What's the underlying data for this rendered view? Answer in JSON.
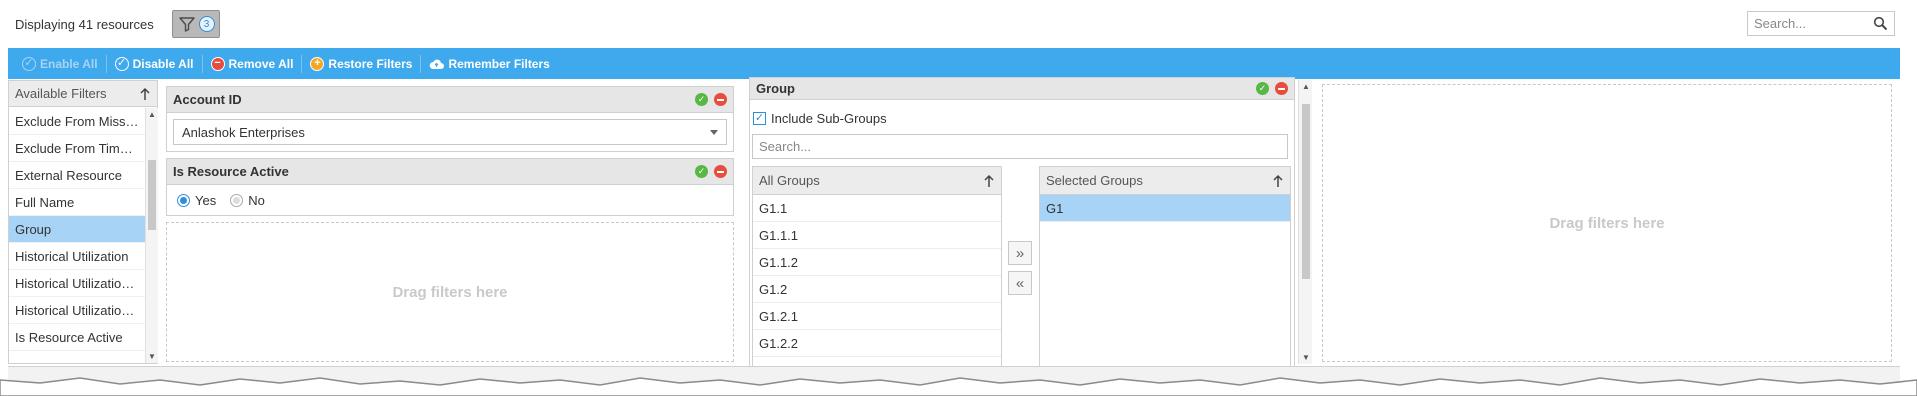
{
  "header": {
    "count_text": "Displaying 41 resources",
    "filter_badge": "3",
    "search_placeholder": "Search..."
  },
  "toolbar": {
    "enable_all": "Enable All",
    "disable_all": "Disable All",
    "remove_all": "Remove All",
    "restore_filters": "Restore Filters",
    "remember_filters": "Remember Filters"
  },
  "available_filters": {
    "title": "Available Filters",
    "items": [
      {
        "label": "Exclude From Miss…",
        "selected": false
      },
      {
        "label": "Exclude From Tim…",
        "selected": false
      },
      {
        "label": "External Resource",
        "selected": false
      },
      {
        "label": "Full Name",
        "selected": false
      },
      {
        "label": "Group",
        "selected": true
      },
      {
        "label": "Historical Utilization",
        "selected": false
      },
      {
        "label": "Historical Utilizatio…",
        "selected": false
      },
      {
        "label": "Historical Utilizatio…",
        "selected": false
      },
      {
        "label": "Is Resource Active",
        "selected": false
      }
    ]
  },
  "account_filter": {
    "title": "Account ID",
    "value": "Anlashok Enterprises"
  },
  "active_filter": {
    "title": "Is Resource Active",
    "yes_label": "Yes",
    "no_label": "No",
    "selected": "Yes"
  },
  "drop_zone_text": "Drag filters here",
  "group_filter": {
    "title": "Group",
    "include_subgroups_label": "Include Sub-Groups",
    "include_subgroups_checked": true,
    "search_placeholder": "Search...",
    "all_groups_title": "All Groups",
    "all_groups": [
      "G1.1",
      "G1.1.1",
      "G1.1.2",
      "G1.2",
      "G1.2.1",
      "G1.2.2"
    ],
    "selected_groups_title": "Selected Groups",
    "selected_groups": [
      "G1"
    ]
  },
  "colors": {
    "toolbar": "#3ea9ec",
    "selection": "#a7d3f6",
    "ok": "#57b846",
    "remove": "#e74c3c",
    "restore": "#f5a623"
  }
}
